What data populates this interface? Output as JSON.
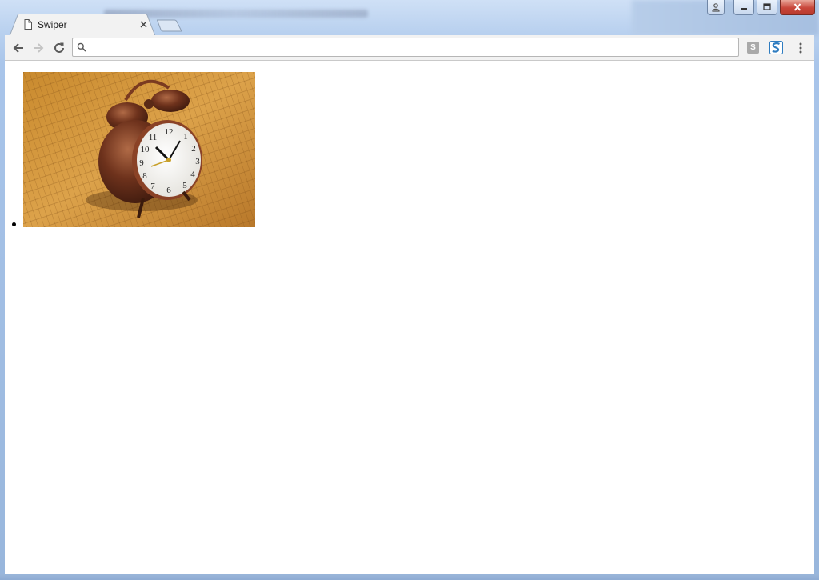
{
  "window": {
    "controls": {
      "profile_icon": "user-icon",
      "minimize_icon": "minimize-icon",
      "maximize_icon": "maximize-icon",
      "close_icon": "close-icon"
    },
    "accent_color": "#c8463a"
  },
  "tab": {
    "title": "Swiper",
    "icon": "document-icon",
    "close_icon": "close-icon"
  },
  "toolbar": {
    "back_icon": "arrow-left-icon",
    "forward_icon": "arrow-right-icon",
    "reload_icon": "reload-icon",
    "address": {
      "value": "",
      "placeholder": "",
      "icon": "search-icon"
    },
    "extensions": [
      {
        "name": "s-extension-icon",
        "label": "S"
      },
      {
        "name": "blue-s-extension-icon"
      }
    ],
    "menu_icon": "kebab-menu-icon"
  },
  "page": {
    "slides": [
      {
        "image": "alarm-clock-photo",
        "subject": "copper twin-bell alarm clock on bamboo mat"
      }
    ]
  }
}
